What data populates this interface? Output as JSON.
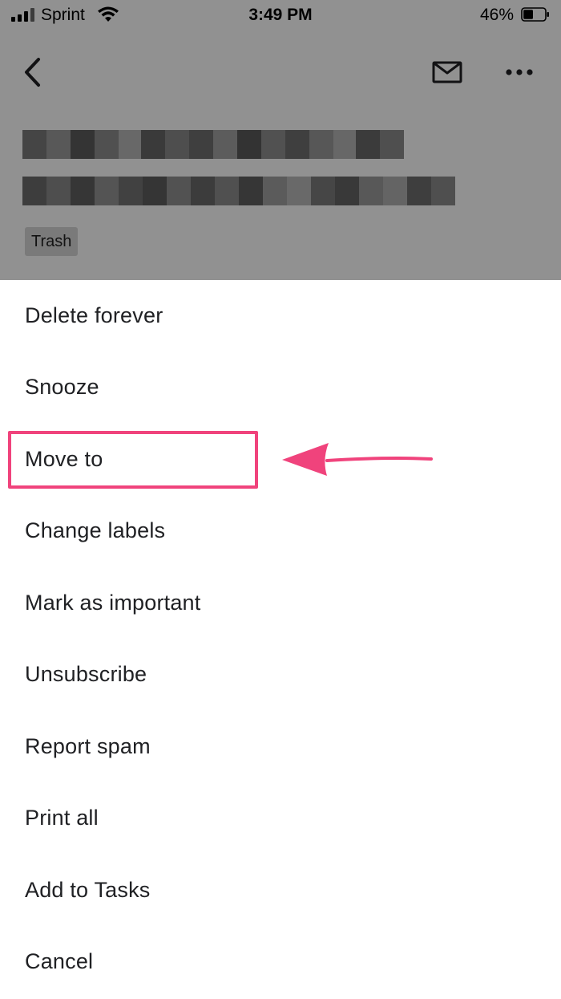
{
  "status_bar": {
    "carrier": "Sprint",
    "time": "3:49 PM",
    "battery_percent": "46%",
    "battery_level": 0.46
  },
  "header": {
    "back_icon": "chevron-left-icon",
    "mail_icon": "mail-icon",
    "more_icon": "more-horizontal-icon"
  },
  "email": {
    "label_chip": "Trash"
  },
  "menu": {
    "items": [
      {
        "label": "Delete forever"
      },
      {
        "label": "Snooze"
      },
      {
        "label": "Move to"
      },
      {
        "label": "Change labels"
      },
      {
        "label": "Mark as important"
      },
      {
        "label": "Unsubscribe"
      },
      {
        "label": "Report spam"
      },
      {
        "label": "Print all"
      },
      {
        "label": "Add to Tasks"
      },
      {
        "label": "Cancel"
      }
    ]
  },
  "annotation": {
    "highlighted_item": "Move to",
    "color": "#f0437c"
  },
  "colors": {
    "dim_overlay": "rgba(0,0,0,0.43)",
    "menu_text": "#202124",
    "annotation": "#f0437c"
  }
}
